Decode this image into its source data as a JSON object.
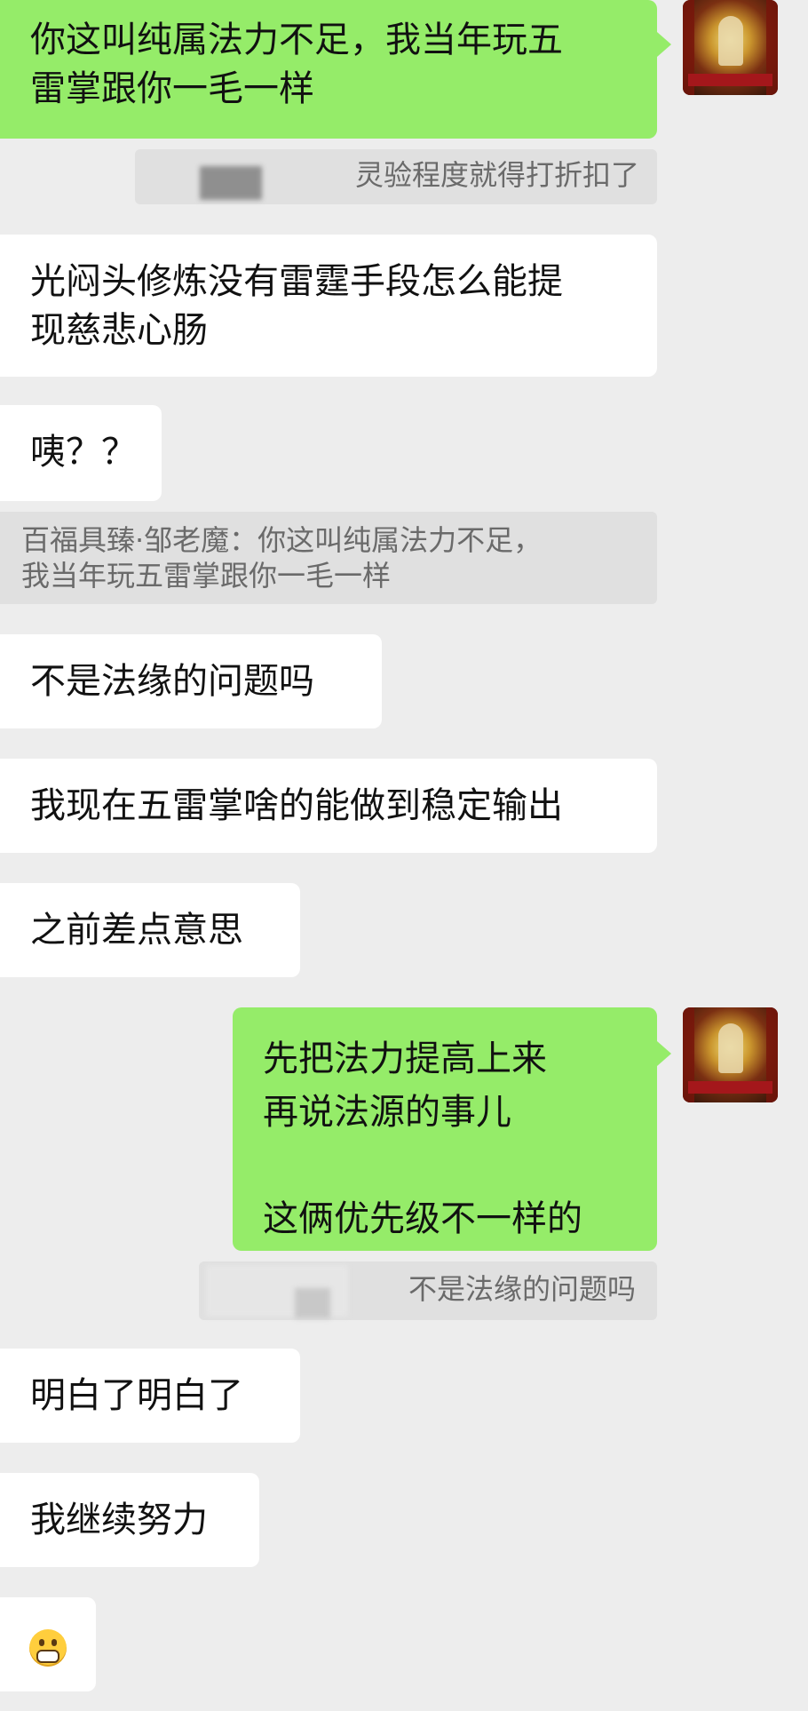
{
  "messages": [
    {
      "text": "你这叫纯属法力不足，我当年玩五\n雷掌跟你一毛一样"
    },
    {
      "quote": "灵验程度就得打折扣了"
    },
    {
      "text": "光闷头修炼没有雷霆手段怎么能提\n现慈悲心肠"
    },
    {
      "text": "咦？？"
    },
    {
      "quote": "百福具臻·邹老魔：你这叫纯属法力不足，\n我当年玩五雷掌跟你一毛一样"
    },
    {
      "text": "不是法缘的问题吗"
    },
    {
      "text": "我现在五雷掌啥的能做到稳定输出"
    },
    {
      "text": "之前差点意思"
    },
    {
      "text": "先把法力提高上来\n再说法源的事儿\n\n这俩优先级不一样的"
    },
    {
      "quote": "不是法缘的问题吗"
    },
    {
      "text": "明白了明白了"
    },
    {
      "text": "我继续努力"
    }
  ],
  "emoji_icon": "grinning-face-icon",
  "avatar_icon": "deity-shrine-avatar",
  "colors": {
    "background": "#ededed",
    "incoming": "#ffffff",
    "outgoing": "#95ec69",
    "quote": "#e0e0e0"
  }
}
